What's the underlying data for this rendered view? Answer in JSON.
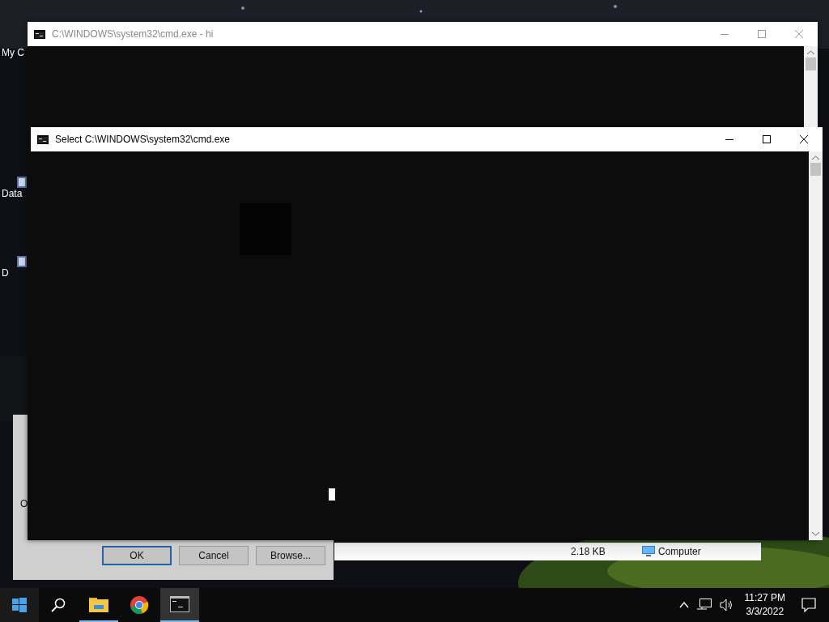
{
  "desktop": {
    "icons": [
      {
        "label": "My C"
      },
      {
        "label": "Data"
      },
      {
        "label": "D"
      }
    ]
  },
  "background_window": {
    "title": "C:\\WINDOWS\\system32\\cmd.exe - hi",
    "active": false
  },
  "run_dialog": {
    "text": "O",
    "buttons": [
      {
        "label": "OK",
        "default": true
      },
      {
        "label": "Cancel",
        "default": false
      },
      {
        "label": "Browse...",
        "default": false
      }
    ]
  },
  "explorer_status": {
    "size": "2.18 KB",
    "location": "Computer"
  },
  "console_window": {
    "title": "Select C:\\WINDOWS\\system32\\cmd.exe",
    "active": true
  },
  "taskbar": {
    "apps": [
      {
        "kind": "explorer",
        "running": true,
        "selected": false
      },
      {
        "kind": "chrome",
        "running": false,
        "selected": false
      },
      {
        "kind": "console",
        "running": true,
        "selected": true
      }
    ],
    "time": "11:27 PM",
    "date": "3/3/2022"
  }
}
